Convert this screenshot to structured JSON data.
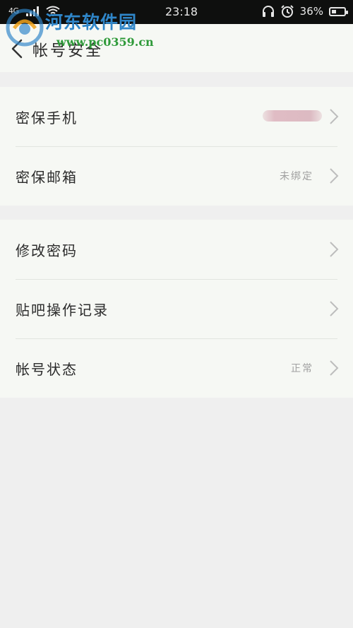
{
  "status_bar": {
    "network": "4G",
    "time": "23:18",
    "battery_percent": "36%",
    "battery_level": 0.36,
    "icons": [
      "signal-icon",
      "wifi-icon",
      "headphones-icon",
      "alarm-icon",
      "battery-icon"
    ]
  },
  "watermark": {
    "title": "河东软件园",
    "url": "www.pc0359.cn"
  },
  "header": {
    "title": "帐号安全",
    "back_icon": "chevron-left-icon"
  },
  "groups": [
    {
      "rows": [
        {
          "label": "密保手机",
          "value": "",
          "redacted": true
        },
        {
          "label": "密保邮箱",
          "value": "未绑定"
        }
      ]
    },
    {
      "rows": [
        {
          "label": "修改密码",
          "value": ""
        },
        {
          "label": "贴吧操作记录",
          "value": ""
        },
        {
          "label": "帐号状态",
          "value": "正常"
        }
      ]
    }
  ],
  "colors": {
    "background": "#efefef",
    "card": "#f6f8f4",
    "status_bar": "#0e0f0e",
    "label_text": "#2b2b2b",
    "value_text": "#a0a0a0",
    "chevron": "#bdbdbd",
    "watermark_blue": "#2f86c9",
    "watermark_green": "#2f9a3a"
  }
}
